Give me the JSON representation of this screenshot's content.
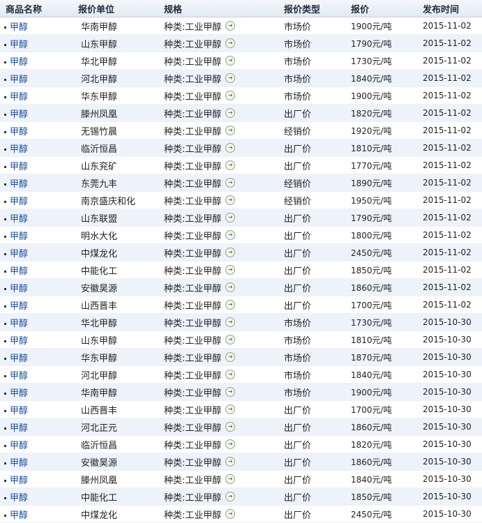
{
  "header": {
    "col_name": "商品名称",
    "col_unit": "报价单位",
    "col_spec": "规格",
    "col_type": "报价类型",
    "col_price": "报价",
    "col_date": "发布时间"
  },
  "rows": [
    {
      "name": "甲醇",
      "unit": "华南甲醇",
      "spec": "种类:工业甲醇",
      "type": "市场价",
      "price": "1900元/吨",
      "date": "2015-11-02"
    },
    {
      "name": "甲醇",
      "unit": "山东甲醇",
      "spec": "种类:工业甲醇",
      "type": "市场价",
      "price": "1790元/吨",
      "date": "2015-11-02"
    },
    {
      "name": "甲醇",
      "unit": "华北甲醇",
      "spec": "种类:工业甲醇",
      "type": "市场价",
      "price": "1730元/吨",
      "date": "2015-11-02"
    },
    {
      "name": "甲醇",
      "unit": "河北甲醇",
      "spec": "种类:工业甲醇",
      "type": "市场价",
      "price": "1840元/吨",
      "date": "2015-11-02"
    },
    {
      "name": "甲醇",
      "unit": "华东甲醇",
      "spec": "种类:工业甲醇",
      "type": "市场价",
      "price": "1900元/吨",
      "date": "2015-11-02"
    },
    {
      "name": "甲醇",
      "unit": "滕州凤凰",
      "spec": "种类:工业甲醇",
      "type": "出厂价",
      "price": "1820元/吨",
      "date": "2015-11-02"
    },
    {
      "name": "甲醇",
      "unit": "无锡竹晨",
      "spec": "种类:工业甲醇",
      "type": "经销价",
      "price": "1920元/吨",
      "date": "2015-11-02"
    },
    {
      "name": "甲醇",
      "unit": "临沂恒昌",
      "spec": "种类:工业甲醇",
      "type": "出厂价",
      "price": "1810元/吨",
      "date": "2015-11-02"
    },
    {
      "name": "甲醇",
      "unit": "山东兖矿",
      "spec": "种类:工业甲醇",
      "type": "出厂价",
      "price": "1770元/吨",
      "date": "2015-11-02"
    },
    {
      "name": "甲醇",
      "unit": "东莞九丰",
      "spec": "种类:工业甲醇",
      "type": "经销价",
      "price": "1890元/吨",
      "date": "2015-11-02"
    },
    {
      "name": "甲醇",
      "unit": "南京盛庆和化",
      "spec": "种类:工业甲醇",
      "type": "经销价",
      "price": "1950元/吨",
      "date": "2015-11-02"
    },
    {
      "name": "甲醇",
      "unit": "山东联盟",
      "spec": "种类:工业甲醇",
      "type": "出厂价",
      "price": "1790元/吨",
      "date": "2015-11-02"
    },
    {
      "name": "甲醇",
      "unit": "明水大化",
      "spec": "种类:工业甲醇",
      "type": "出厂价",
      "price": "1800元/吨",
      "date": "2015-11-02"
    },
    {
      "name": "甲醇",
      "unit": "中煤龙化",
      "spec": "种类:工业甲醇",
      "type": "出厂价",
      "price": "2450元/吨",
      "date": "2015-11-02"
    },
    {
      "name": "甲醇",
      "unit": "中能化工",
      "spec": "种类:工业甲醇",
      "type": "出厂价",
      "price": "1850元/吨",
      "date": "2015-11-02"
    },
    {
      "name": "甲醇",
      "unit": "安徽昊源",
      "spec": "种类:工业甲醇",
      "type": "出厂价",
      "price": "1860元/吨",
      "date": "2015-11-02"
    },
    {
      "name": "甲醇",
      "unit": "山西晋丰",
      "spec": "种类:工业甲醇",
      "type": "出厂价",
      "price": "1700元/吨",
      "date": "2015-11-02"
    },
    {
      "name": "甲醇",
      "unit": "华北甲醇",
      "spec": "种类:工业甲醇",
      "type": "市场价",
      "price": "1730元/吨",
      "date": "2015-10-30"
    },
    {
      "name": "甲醇",
      "unit": "山东甲醇",
      "spec": "种类:工业甲醇",
      "type": "市场价",
      "price": "1810元/吨",
      "date": "2015-10-30"
    },
    {
      "name": "甲醇",
      "unit": "华东甲醇",
      "spec": "种类:工业甲醇",
      "type": "市场价",
      "price": "1870元/吨",
      "date": "2015-10-30"
    },
    {
      "name": "甲醇",
      "unit": "河北甲醇",
      "spec": "种类:工业甲醇",
      "type": "市场价",
      "price": "1840元/吨",
      "date": "2015-10-30"
    },
    {
      "name": "甲醇",
      "unit": "华南甲醇",
      "spec": "种类:工业甲醇",
      "type": "市场价",
      "price": "1900元/吨",
      "date": "2015-10-30"
    },
    {
      "name": "甲醇",
      "unit": "山西晋丰",
      "spec": "种类:工业甲醇",
      "type": "出厂价",
      "price": "1700元/吨",
      "date": "2015-10-30"
    },
    {
      "name": "甲醇",
      "unit": "河北正元",
      "spec": "种类:工业甲醇",
      "type": "出厂价",
      "price": "1860元/吨",
      "date": "2015-10-30"
    },
    {
      "name": "甲醇",
      "unit": "临沂恒昌",
      "spec": "种类:工业甲醇",
      "type": "出厂价",
      "price": "1820元/吨",
      "date": "2015-10-30"
    },
    {
      "name": "甲醇",
      "unit": "安徽昊源",
      "spec": "种类:工业甲醇",
      "type": "出厂价",
      "price": "1860元/吨",
      "date": "2015-10-30"
    },
    {
      "name": "甲醇",
      "unit": "滕州凤凰",
      "spec": "种类:工业甲醇",
      "type": "出厂价",
      "price": "1840元/吨",
      "date": "2015-10-30"
    },
    {
      "name": "甲醇",
      "unit": "中能化工",
      "spec": "种类:工业甲醇",
      "type": "出厂价",
      "price": "1850元/吨",
      "date": "2015-10-30"
    },
    {
      "name": "甲醇",
      "unit": "中煤龙化",
      "spec": "种类:工业甲醇",
      "type": "出厂价",
      "price": "2450元/吨",
      "date": "2015-10-30"
    }
  ],
  "icons": {
    "row_bullet": "bullet-icon",
    "spec_arrow": "arrow-right-circle-icon"
  },
  "colors": {
    "link": "#1a4e9c",
    "row_alt": "#eef2fa",
    "header_bg": "#e3e9f2"
  }
}
